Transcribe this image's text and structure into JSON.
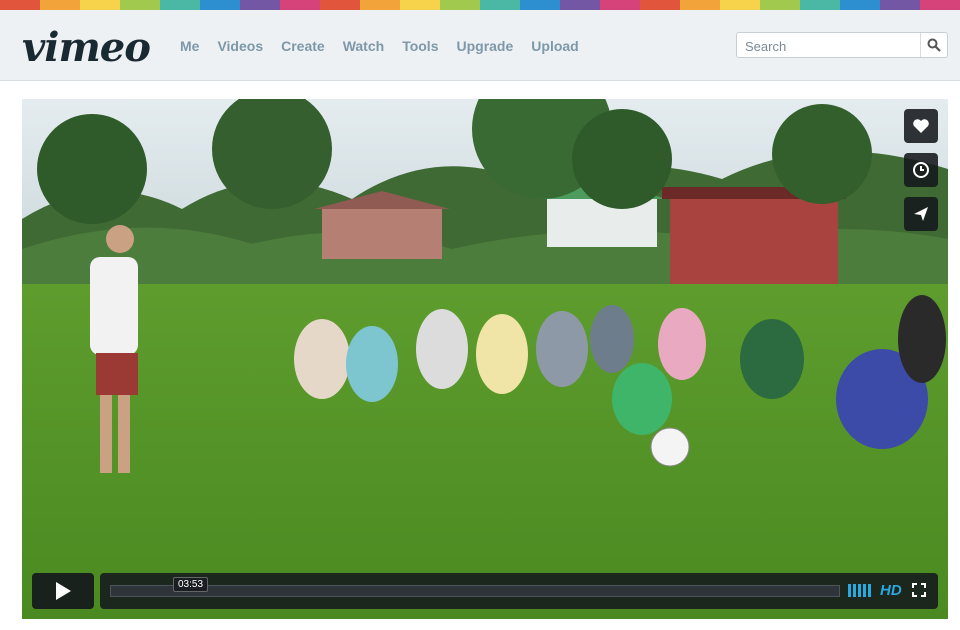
{
  "stripe_colors": [
    "#e2553d",
    "#f2a33a",
    "#f6d34a",
    "#a0c94e",
    "#4bb7a5",
    "#2d8fcf",
    "#7357a5",
    "#d6437a",
    "#e2553d",
    "#f2a33a",
    "#f6d34a",
    "#a0c94e",
    "#4bb7a5",
    "#2d8fcf",
    "#7357a5",
    "#d6437a",
    "#e2553d",
    "#f2a33a",
    "#f6d34a",
    "#a0c94e",
    "#4bb7a5",
    "#2d8fcf",
    "#7357a5",
    "#d6437a"
  ],
  "header": {
    "logo": "vimeo",
    "nav": [
      "Me",
      "Videos",
      "Create",
      "Watch",
      "Tools",
      "Upgrade",
      "Upload"
    ],
    "search_placeholder": "Search"
  },
  "player": {
    "time": "03:53",
    "hd_label": "HD",
    "side_buttons": [
      "heart-icon",
      "clock-icon",
      "send-icon"
    ],
    "accent_color": "#2aa8e0"
  }
}
